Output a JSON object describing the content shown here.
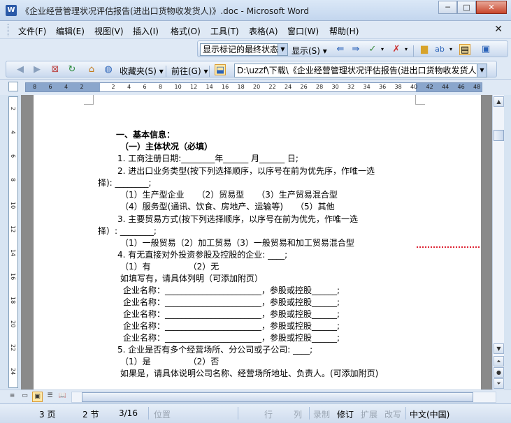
{
  "window": {
    "title": "《企业经营管理状况评估报告(进出口货物收发货人)》.doc - Microsoft Word",
    "app_icon": "W",
    "buttons": {
      "minimize": "─",
      "maximize": "□",
      "close": "✕"
    }
  },
  "menu": {
    "items": [
      "文件(F)",
      "编辑(E)",
      "视图(V)",
      "插入(I)",
      "格式(O)",
      "工具(T)",
      "表格(A)",
      "窗口(W)",
      "帮助(H)"
    ],
    "close_doc": "✕"
  },
  "review_toolbar": {
    "display_mode": "显示标记的最终状态",
    "show_label": "显示(S)"
  },
  "web_toolbar": {
    "favorites_label": "收藏夹(S)",
    "goto_label": "前往(G)",
    "address": "D:\\uzzf\\下载\\《企业经营管理状况评估报告(进出口货物收发货人"
  },
  "ruler": {
    "h_labels": [
      "8",
      "6",
      "4",
      "2",
      "",
      "2",
      "4",
      "6",
      "8",
      "10",
      "12",
      "14",
      "16",
      "18",
      "20",
      "22",
      "24",
      "26",
      "28",
      "30",
      "32",
      "34",
      "36",
      "38",
      "40",
      "42",
      "44",
      "46",
      "48"
    ],
    "v_labels": [
      "2",
      "4",
      "6",
      "8",
      "10",
      "12",
      "14",
      "16",
      "18",
      "20",
      "22",
      "24"
    ]
  },
  "document": {
    "lines": [
      "一、基本信息：",
      "（一）主体状况（必填）",
      "1. 工商注册日期:________年______ 月______ 日;",
      "2. 进出口业务类型(按下列选择顺序，以序号在前为优先序，作唯一选",
      "择): ________;",
      "（1）生产型企业　　（2）贸易型　　（3）生产贸易混合型",
      "（4）服务型(通讯、饮食、房地产、运输等)　　（5）其他",
      "3. 主要贸易方式(按下列选择顺序，以序号在前为优先，作唯一选",
      "择）: ________;",
      "（1）一般贸易（2）加工贸易（3）一般贸易和加工贸易混合型",
      "4. 有无直接对外投资参股及控股的企业: ____;",
      "（1）有　　　　　（2）无",
      "如填写有，请具体列明（可添加附页）",
      "企业名称：_______________________，参股或控股______;",
      "企业名称：_______________________，参股或控股______;",
      "企业名称：_______________________，参股或控股______;",
      "企业名称：_______________________，参股或控股______;",
      "企业名称：_______________________，参股或控股______;",
      "5. 企业是否有多个经营场所、分公司或子公司: ____;",
      "（1）是　　　　　（2）否",
      "如果是，请具体说明公司名称、经营场所地址、负责人。(可添加附页)"
    ]
  },
  "status": {
    "page": "3 页",
    "section": "2 节",
    "page_of": "3/16",
    "position": "位置",
    "line": "行",
    "column": "列",
    "record": "录制",
    "revise": "修订",
    "extend": "扩展",
    "overwrite": "改写",
    "language": "中文(中国)"
  }
}
